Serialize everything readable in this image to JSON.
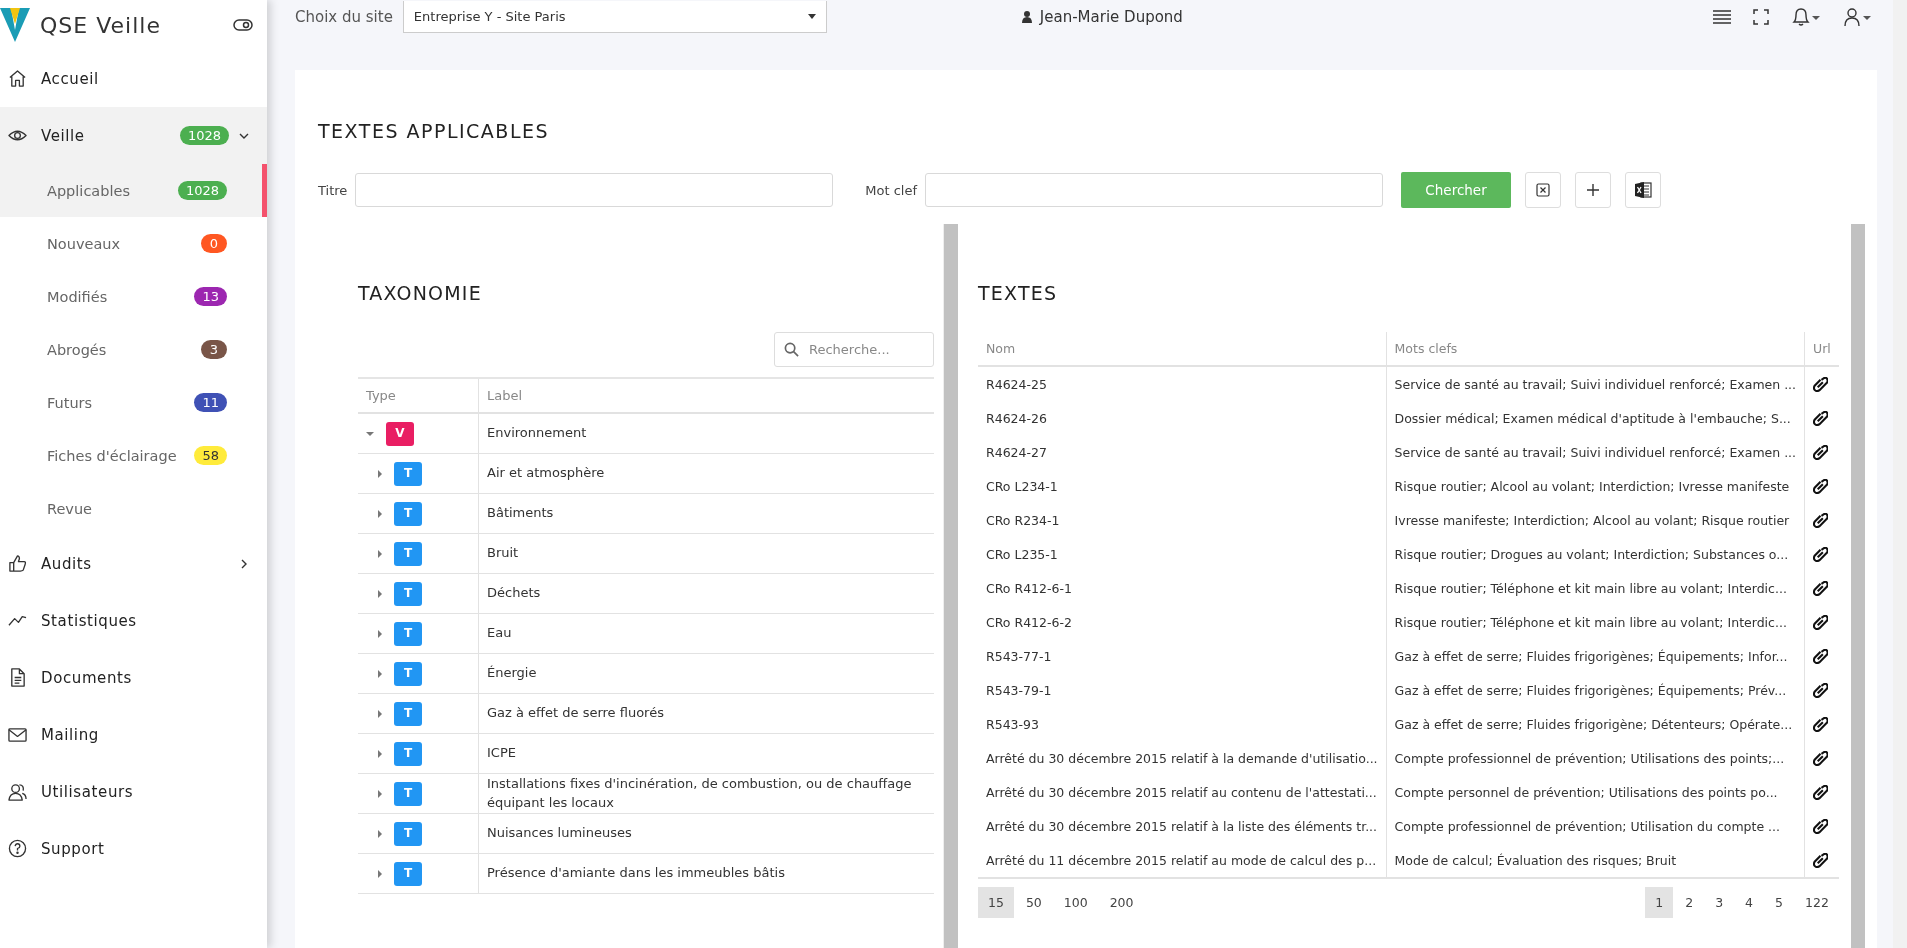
{
  "app": {
    "name": "QSE Veille"
  },
  "sidebar": {
    "items": [
      {
        "label": "Accueil"
      },
      {
        "label": "Veille",
        "badge": "1028",
        "color": "#4caf50",
        "expanded": true,
        "children": [
          {
            "label": "Applicables",
            "badge": "1028",
            "color": "#4caf50",
            "selected": true
          },
          {
            "label": "Nouveaux",
            "badge": "0",
            "color": "#ff5722",
            "selected": false
          },
          {
            "label": "Modifiés",
            "badge": "13",
            "color": "#9c27b0",
            "selected": false
          },
          {
            "label": "Abrogés",
            "badge": "3",
            "color": "#795548",
            "selected": false
          },
          {
            "label": "Futurs",
            "badge": "11",
            "color": "#3f51b5",
            "selected": false
          },
          {
            "label": "Fiches d'éclairage",
            "badge": "58",
            "color": "#ffeb3b",
            "selected": false
          },
          {
            "label": "Revue",
            "selected": false
          }
        ]
      },
      {
        "label": "Audits",
        "expanded": false
      },
      {
        "label": "Statistiques"
      },
      {
        "label": "Documents"
      },
      {
        "label": "Mailing"
      },
      {
        "label": "Utilisateurs"
      },
      {
        "label": "Support"
      }
    ]
  },
  "topbar": {
    "site_label": "Choix du site",
    "site_value": "Entreprise Y - Site Paris",
    "user": "Jean-Marie Dupond"
  },
  "page": {
    "title": "TEXTES APPLICABLES",
    "filters": {
      "title_label": "Titre",
      "keyword_label": "Mot clef",
      "search_button": "Chercher"
    },
    "taxonomy": {
      "title": "TAXONOMIE",
      "search_placeholder": "Recherche...",
      "columns": [
        "Type",
        "Label"
      ],
      "tree": [
        {
          "type": "V",
          "kind": "domain",
          "label": "Environnement",
          "expanded": true,
          "children": [
            {
              "type": "T",
              "kind": "theme",
              "label": "Air et atmosphère",
              "expanded": false
            },
            {
              "type": "T",
              "kind": "theme",
              "label": "Bâtiments",
              "expanded": false
            },
            {
              "type": "T",
              "kind": "theme",
              "label": "Bruit",
              "expanded": false
            },
            {
              "type": "T",
              "kind": "theme",
              "label": "Déchets",
              "expanded": false
            },
            {
              "type": "T",
              "kind": "theme",
              "label": "Eau",
              "expanded": false
            },
            {
              "type": "T",
              "kind": "theme",
              "label": "Énergie",
              "expanded": false
            },
            {
              "type": "T",
              "kind": "theme",
              "label": "Gaz à effet de serre fluorés",
              "expanded": false
            },
            {
              "type": "T",
              "kind": "theme",
              "label": "ICPE",
              "expanded": false
            },
            {
              "type": "T",
              "kind": "theme",
              "label": "Installations fixes d'incinération, de combustion, ou de chauffage équipant les locaux",
              "expanded": false
            },
            {
              "type": "T",
              "kind": "theme",
              "label": "Nuisances lumineuses",
              "expanded": false
            },
            {
              "type": "T",
              "kind": "theme",
              "label": "Présence d'amiante dans les immeubles bâtis",
              "expanded": false
            }
          ]
        }
      ]
    },
    "texts": {
      "title": "TEXTES",
      "columns": [
        "Nom",
        "Mots clefs",
        "Url"
      ],
      "rows": [
        {
          "name": "R4624-25",
          "keywords": "Service de santé au travail; Suivi individuel renforcé; Examen ..."
        },
        {
          "name": "R4624-26",
          "keywords": "Dossier médical; Examen médical d'aptitude à l'embauche; S..."
        },
        {
          "name": "R4624-27",
          "keywords": "Service de santé au travail; Suivi individuel renforcé; Examen ..."
        },
        {
          "name": "CRo L234-1",
          "keywords": "Risque routier; Alcool au volant; Interdiction; Ivresse manifeste"
        },
        {
          "name": "CRo R234-1",
          "keywords": "Ivresse manifeste; Interdiction; Alcool au volant; Risque routier"
        },
        {
          "name": "CRo L235-1",
          "keywords": "Risque routier; Drogues au volant; Interdiction; Substances o..."
        },
        {
          "name": "CRo R412-6-1",
          "keywords": "Risque routier; Téléphone et kit main libre au volant; Interdic..."
        },
        {
          "name": "CRo R412-6-2",
          "keywords": "Risque routier; Téléphone et kit main libre au volant; Interdic..."
        },
        {
          "name": "R543-77-1",
          "keywords": "Gaz à effet de serre; Fluides frigorigènes; Équipements; Infor..."
        },
        {
          "name": "R543-79-1",
          "keywords": "Gaz à effet de serre; Fluides frigorigènes; Équipements; Prév..."
        },
        {
          "name": "R543-93",
          "keywords": "Gaz à effet de serre; Fluides frigorigène; Détenteurs; Opérate..."
        },
        {
          "name": "Arrêté du 30 décembre 2015 relatif à la demande d'utilisatio...",
          "keywords": "Compte professionnel de prévention; Utilisations des points;..."
        },
        {
          "name": "Arrêté du 30 décembre 2015 relatif au contenu de l'attestati...",
          "keywords": "Compte personnel de prévention; Utilisations des points po..."
        },
        {
          "name": "Arrêté du 30 décembre 2015 relatif à la liste des éléments tr...",
          "keywords": "Compte professionnel de prévention; Utilisation du compte ..."
        },
        {
          "name": "Arrêté du 11 décembre 2015 relatif au mode de calcul des p...",
          "keywords": "Mode de calcul; Évaluation des risques; Bruit"
        }
      ],
      "page_sizes": [
        {
          "label": "15",
          "selected": true
        },
        {
          "label": "50",
          "selected": false
        },
        {
          "label": "100",
          "selected": false
        },
        {
          "label": "200",
          "selected": false
        }
      ],
      "pages": [
        {
          "label": "1",
          "selected": true
        },
        {
          "label": "2",
          "selected": false
        },
        {
          "label": "3",
          "selected": false
        },
        {
          "label": "4",
          "selected": false
        },
        {
          "label": "5",
          "selected": false
        },
        {
          "label": "122",
          "selected": false
        }
      ]
    }
  }
}
